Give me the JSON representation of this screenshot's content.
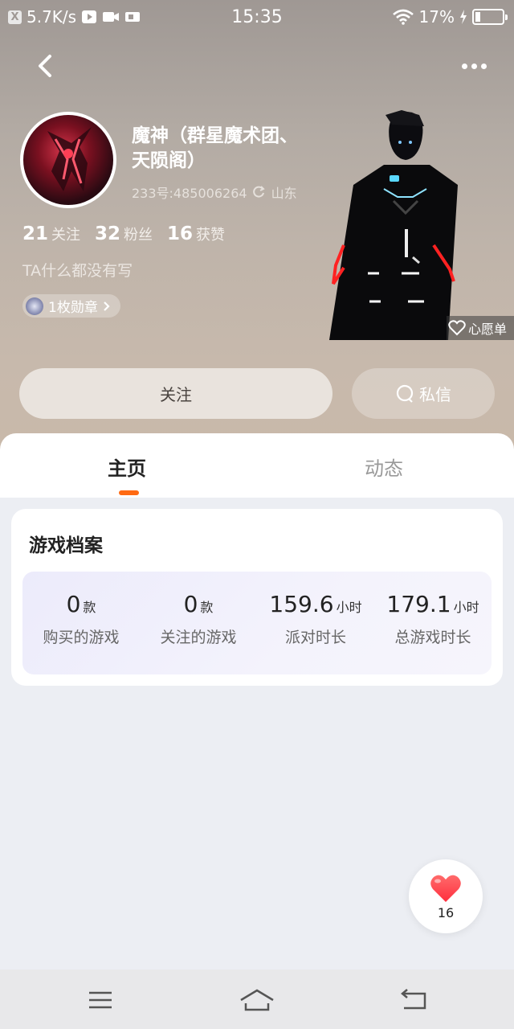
{
  "status_bar": {
    "net_speed": "5.7K/s",
    "time": "15:35",
    "battery": "17%",
    "left_badge": "X"
  },
  "profile": {
    "name_line1": "魔神（群星魔术团、",
    "name_line2": "天陨阁）",
    "uid": "233号:485006264",
    "location": "山东",
    "following_count": "21",
    "following_label": "关注",
    "fans_count": "32",
    "fans_label": "粉丝",
    "likes_count": "16",
    "likes_label": "获赞",
    "bio": "TA什么都没有写",
    "medal_label": "1枚勋章",
    "wishlist_label": "心愿单"
  },
  "actions": {
    "follow_label": "关注",
    "message_label": "私信"
  },
  "tabs": [
    {
      "label": "主页",
      "active": true
    },
    {
      "label": "动态",
      "active": false
    }
  ],
  "game_profile": {
    "title": "游戏档案",
    "stats": [
      {
        "value": "0",
        "unit": "款",
        "label": "购买的游戏"
      },
      {
        "value": "0",
        "unit": "款",
        "label": "关注的游戏"
      },
      {
        "value": "159.6",
        "unit": "小时",
        "label": "派对时长"
      },
      {
        "value": "179.1",
        "unit": "小时",
        "label": "总游戏时长"
      }
    ]
  },
  "like_fab": {
    "count": "16"
  },
  "colors": {
    "accent": "#ff6a13",
    "like_heart": "#ff3b3b"
  }
}
